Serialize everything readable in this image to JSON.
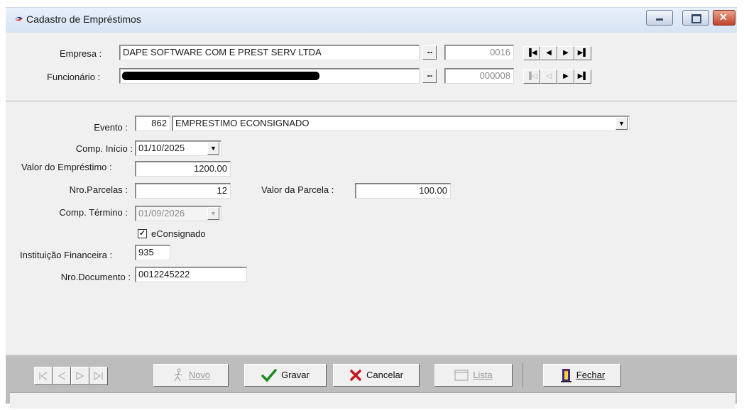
{
  "window": {
    "title": "Cadastro de Empréstimos"
  },
  "header": {
    "empresa_label": "Empresa :",
    "empresa_value": "DAPE SOFTWARE COM E PREST SERV LTDA",
    "empresa_code": "0016",
    "funcionario_label": "Funcionário :",
    "funcionario_code": "000008",
    "lookup_button": "..."
  },
  "form": {
    "evento_label": "Evento :",
    "evento_code": "862",
    "evento_value": "EMPRESTIMO ECONSIGNADO",
    "comp_inicio_label": "Comp. Início :",
    "comp_inicio_value": "01/10/2025",
    "valor_emprestimo_label": "Valor do Empréstimo :",
    "valor_emprestimo_value": "1200.00",
    "nro_parcelas_label": "Nro.Parcelas :",
    "nro_parcelas_value": "12",
    "valor_parcela_label": "Valor da Parcela :",
    "valor_parcela_value": "100.00",
    "comp_termino_label": "Comp. Término :",
    "comp_termino_value": "01/09/2026",
    "econsignado_label": "eConsignado",
    "econsignado_checked": true,
    "instituicao_label": "Instituição Financeira :",
    "instituicao_value": "935",
    "nro_documento_label": "Nro.Documento :",
    "nro_documento_value": "0012245222"
  },
  "toolbar": {
    "novo_label": "Novo",
    "gravar_label": "Gravar",
    "cancelar_label": "Cancelar",
    "lista_label": "Lista",
    "fechar_label": "Fechar"
  },
  "colors": {
    "panel": "#f0f0f0",
    "toolbar": "#bdbdbd",
    "titlebar": "#dbe6f4",
    "check_green": "#1c8a1c",
    "cancel_red": "#c8141e",
    "close_button": "#c7472e"
  },
  "icons": {
    "title": "app-arrow-icon",
    "gravar": "checkmark-icon",
    "cancelar": "x-icon",
    "novo": "walking-person-icon",
    "lista": "list-window-icon",
    "fechar": "door-exit-icon"
  }
}
